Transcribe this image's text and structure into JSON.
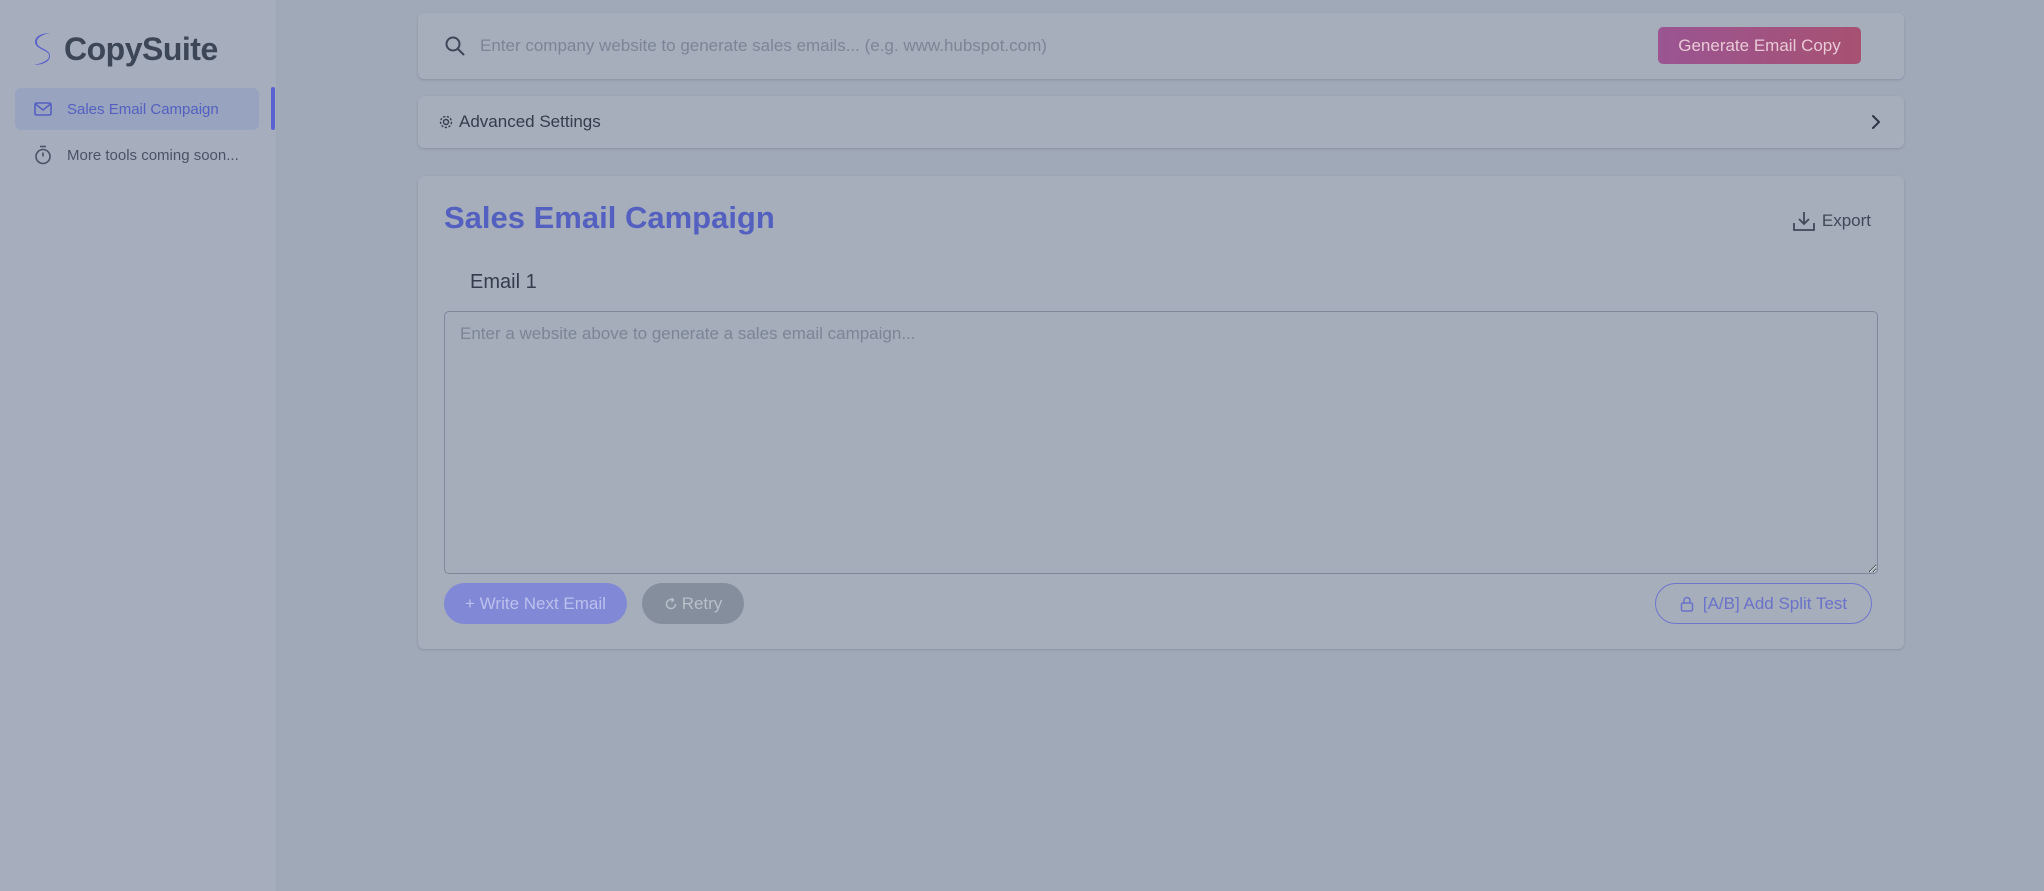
{
  "app": {
    "name": "CopySuite",
    "logo_icon": "s-logo-icon"
  },
  "sidebar": {
    "items": [
      {
        "label": "Sales Email Campaign",
        "icon": "mail-icon",
        "active": true
      },
      {
        "label": "More tools coming soon...",
        "icon": "stopwatch-icon",
        "active": false
      }
    ]
  },
  "search": {
    "placeholder": "Enter company website to generate sales emails... (e.g. www.hubspot.com)",
    "value": "",
    "icon": "search-icon",
    "button_label": "Generate Email Copy"
  },
  "advanced": {
    "label": "Advanced Settings",
    "icon": "gear-icon",
    "expand_icon": "chevron-right-icon"
  },
  "campaign": {
    "title": "Sales Email Campaign",
    "export_label": "Export",
    "export_icon": "download-tray-icon",
    "email_label": "Email 1",
    "email_placeholder": "Enter a website above to generate a sales email campaign...",
    "email_value": "",
    "buttons": {
      "next": "+ Write Next Email",
      "retry": "Retry",
      "split": "[A/B] Add Split Test"
    }
  },
  "colors": {
    "accent": "#5b63d3",
    "generate_button": "#a05480",
    "background": "#a0a9b8"
  }
}
